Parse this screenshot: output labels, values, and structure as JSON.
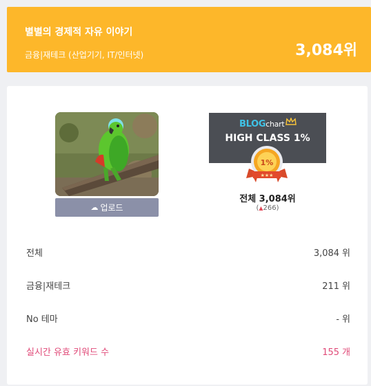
{
  "header": {
    "blog_title": "별별의 경제적 자유 이야기",
    "category": "금융|재테크 (산업기기, IT/인터넷)",
    "rank": "3,084위"
  },
  "profile": {
    "photo": "parrot-photo",
    "upload_label": "업로드",
    "upload_icon": "cloud-upload-icon"
  },
  "badge": {
    "brand_blog": "BLOG",
    "brand_chart": "chart",
    "class_label": "HIGH CLASS 1%",
    "medal_text": "1%",
    "overall_rank": "전체 3,084위",
    "rank_change": "266",
    "rank_change_prefix": "(",
    "rank_change_suffix": ")"
  },
  "stats": [
    {
      "label": "전체",
      "value": "3,084",
      "unit": "위"
    },
    {
      "label": "금융|재테크",
      "value": "211",
      "unit": "위"
    },
    {
      "label": "No 테마",
      "value": "-",
      "unit": "위"
    },
    {
      "label": "실시간 유효 키워드 수",
      "value": "155",
      "unit": "개"
    }
  ],
  "colors": {
    "header_bg": "#fdb72a",
    "badge_bg": "#4b4e54",
    "accent_pink": "#e04a78",
    "upload_btn": "#8b90a8"
  }
}
